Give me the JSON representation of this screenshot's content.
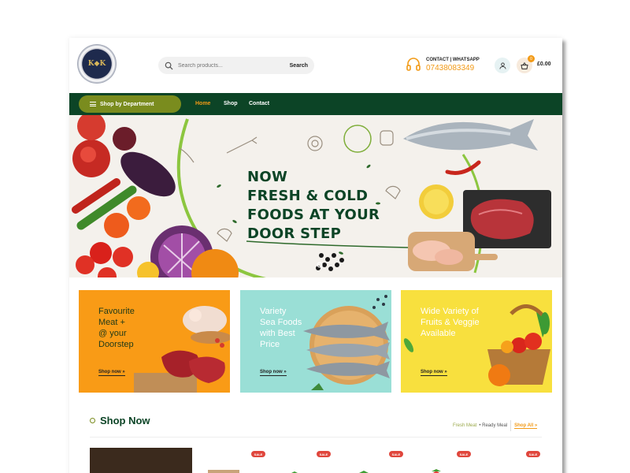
{
  "logo": {
    "text": "K◆K"
  },
  "search": {
    "placeholder": "Search products...",
    "button_label": "Search"
  },
  "contact": {
    "title": "CONTACT | WHATSAPP",
    "phone": "07438083349"
  },
  "cart": {
    "badge": "0",
    "total": "£0.00"
  },
  "nav": {
    "department_label": "Shop by Department",
    "links": [
      "Home",
      "Shop",
      "Contact"
    ],
    "active": "Home"
  },
  "hero": {
    "lines": [
      "NOW",
      "FRESH & COLD",
      "FOODS AT YOUR",
      "DOOR STEP"
    ]
  },
  "promos": [
    {
      "title": "Favourite\nMeat +\n@ your\nDoorstep",
      "link": "Shop now »",
      "bg": "#f99b16",
      "text_color": "#1f3a18"
    },
    {
      "title": "Variety\nSea Foods\nwith Best\nPrice",
      "link": "Shop now »",
      "bg": "#9adfd6",
      "text_color": "#ffffff"
    },
    {
      "title": "Wide Variety of\nFruits & Veggie\nAvailable",
      "link": "Shop now »",
      "bg": "#f8e03e",
      "text_color": "#ffffff"
    }
  ],
  "shop": {
    "title": "Shop Now",
    "tabs": [
      "Fresh Meat",
      "• Ready Meal"
    ],
    "shop_all": "Shop All »"
  },
  "products": {
    "sale_label": "SALE"
  },
  "colors": {
    "brand_green": "#0c4426",
    "accent_orange": "#f29a16",
    "olive": "#7a8c1e"
  }
}
